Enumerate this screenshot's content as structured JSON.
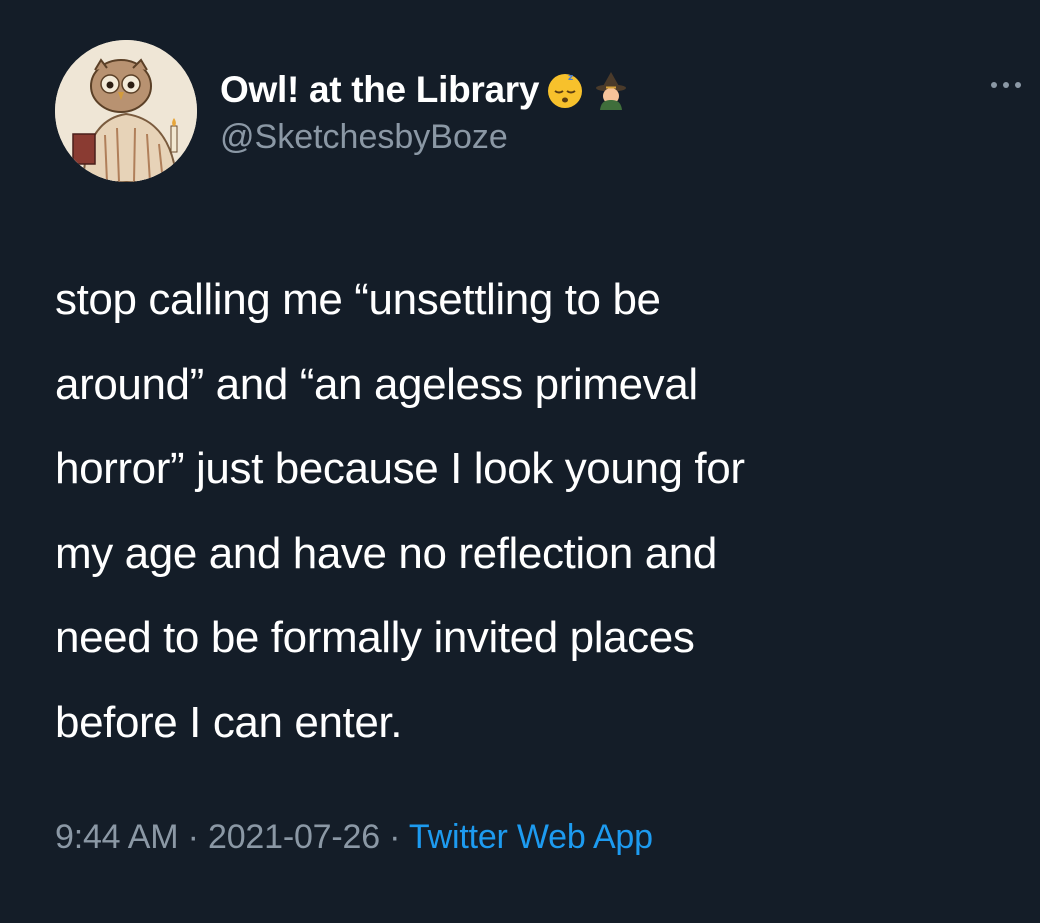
{
  "tweet": {
    "author": {
      "display_name": "Owl! at the Library",
      "handle": "@SketchesbyBoze",
      "emojis": [
        "sleepy-face-icon",
        "witch-icon"
      ]
    },
    "more_icon": "ellipsis-icon",
    "text": "stop calling me “unsettling to be\naround” and “an ageless primeval\nhorror” just because I look young for\nmy age and have no reflection and\nneed to be formally invited places\nbefore I can enter.",
    "meta": {
      "time": "9:44 AM",
      "separator": " · ",
      "date": "2021-07-26",
      "source": "Twitter Web App"
    }
  },
  "colors": {
    "background": "#141d28",
    "text": "#ffffff",
    "secondary": "#8b98a5",
    "accent": "#1d9bf0"
  }
}
